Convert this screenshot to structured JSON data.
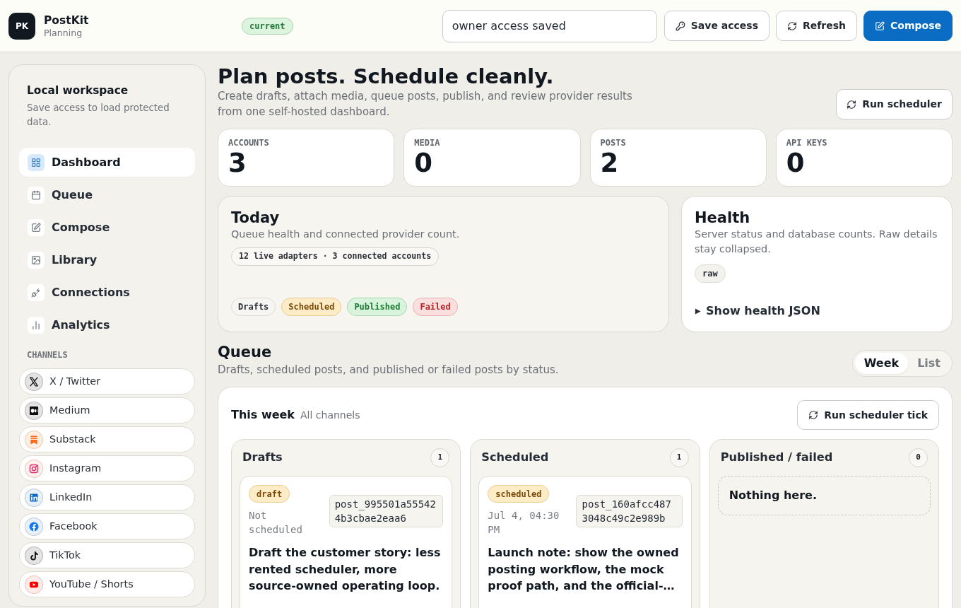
{
  "app": {
    "logo": "PK",
    "name": "PostKit",
    "subtitle": "Planning",
    "env_badge": "current"
  },
  "header": {
    "access_field": {
      "value": "owner access saved"
    },
    "buttons": [
      {
        "label": "Save access",
        "kind": "key",
        "primary": false
      },
      {
        "label": "Refresh",
        "kind": "refresh",
        "primary": false
      },
      {
        "label": "Compose",
        "kind": "compose",
        "primary": true
      }
    ]
  },
  "sidebar": {
    "title": "Local workspace",
    "description": "Save access to load protected data.",
    "nav": [
      {
        "label": "Dashboard",
        "kind": "dashboard",
        "selected": true
      },
      {
        "label": "Queue",
        "kind": "queue",
        "selected": false
      },
      {
        "label": "Compose",
        "kind": "compose",
        "selected": false
      },
      {
        "label": "Library",
        "kind": "library",
        "selected": false
      },
      {
        "label": "Connections",
        "kind": "connections",
        "selected": false
      },
      {
        "label": "Analytics",
        "kind": "analytics",
        "selected": false
      }
    ],
    "channels_heading": "CHANNELS",
    "channels": [
      {
        "label": "X / Twitter",
        "kind": "x"
      },
      {
        "label": "Medium",
        "kind": "medium"
      },
      {
        "label": "Substack",
        "kind": "substack"
      },
      {
        "label": "Instagram",
        "kind": "instagram"
      },
      {
        "label": "LinkedIn",
        "kind": "linkedin"
      },
      {
        "label": "Facebook",
        "kind": "facebook"
      },
      {
        "label": "TikTok",
        "kind": "tiktok"
      },
      {
        "label": "YouTube / Shorts",
        "kind": "youtube"
      }
    ]
  },
  "page": {
    "title": "Plan posts. Schedule cleanly.",
    "description": "Create drafts, attach media, queue posts, publish, and review provider results from one self-hosted dashboard.",
    "action": "Run scheduler"
  },
  "stats": [
    {
      "label": "ACCOUNTS",
      "value": "3"
    },
    {
      "label": "MEDIA",
      "value": "0"
    },
    {
      "label": "POSTS",
      "value": "2"
    },
    {
      "label": "API KEYS",
      "value": "0"
    }
  ],
  "today": {
    "title": "Today",
    "description": "Queue health and connected provider count.",
    "summary": "12 live adapters · 3 connected accounts",
    "statuses": [
      {
        "label": "Drafts",
        "kind": "draft"
      },
      {
        "label": "Scheduled",
        "kind": "scheduled"
      },
      {
        "label": "Published",
        "kind": "published"
      },
      {
        "label": "Failed",
        "kind": "failed"
      }
    ]
  },
  "health": {
    "title": "Health",
    "description": "Server status and database counts. Raw details stay collapsed.",
    "tag": "raw",
    "details": {
      "label": "Show health JSON",
      "expanded": false
    }
  },
  "queue": {
    "title": "Queue",
    "description": "Drafts, scheduled posts, and published or failed posts by status.",
    "views": [
      {
        "label": "Week",
        "selected": true
      },
      {
        "label": "List",
        "selected": false
      }
    ],
    "board": {
      "title": "This week",
      "filter": "All channels",
      "action": "Run scheduler tick",
      "columns": [
        {
          "title": "Drafts",
          "count": "1",
          "posts": [
            {
              "status": "draft",
              "time": "Not scheduled",
              "id": "post_995501a555424b3cbae2eaa6",
              "text": "Draft the customer story: less rented scheduler, more source-owned operating loop."
            }
          ]
        },
        {
          "title": "Scheduled",
          "count": "1",
          "posts": [
            {
              "status": "scheduled",
              "time": "Jul 4, 04:30 PM",
              "id": "post_160afcc4873048c49c2e989b",
              "text": "Launch note: show the owned posting workflow, the mock proof path, and the official-…"
            }
          ]
        },
        {
          "title": "Published / failed",
          "count": "0",
          "empty": "Nothing here."
        }
      ]
    }
  }
}
